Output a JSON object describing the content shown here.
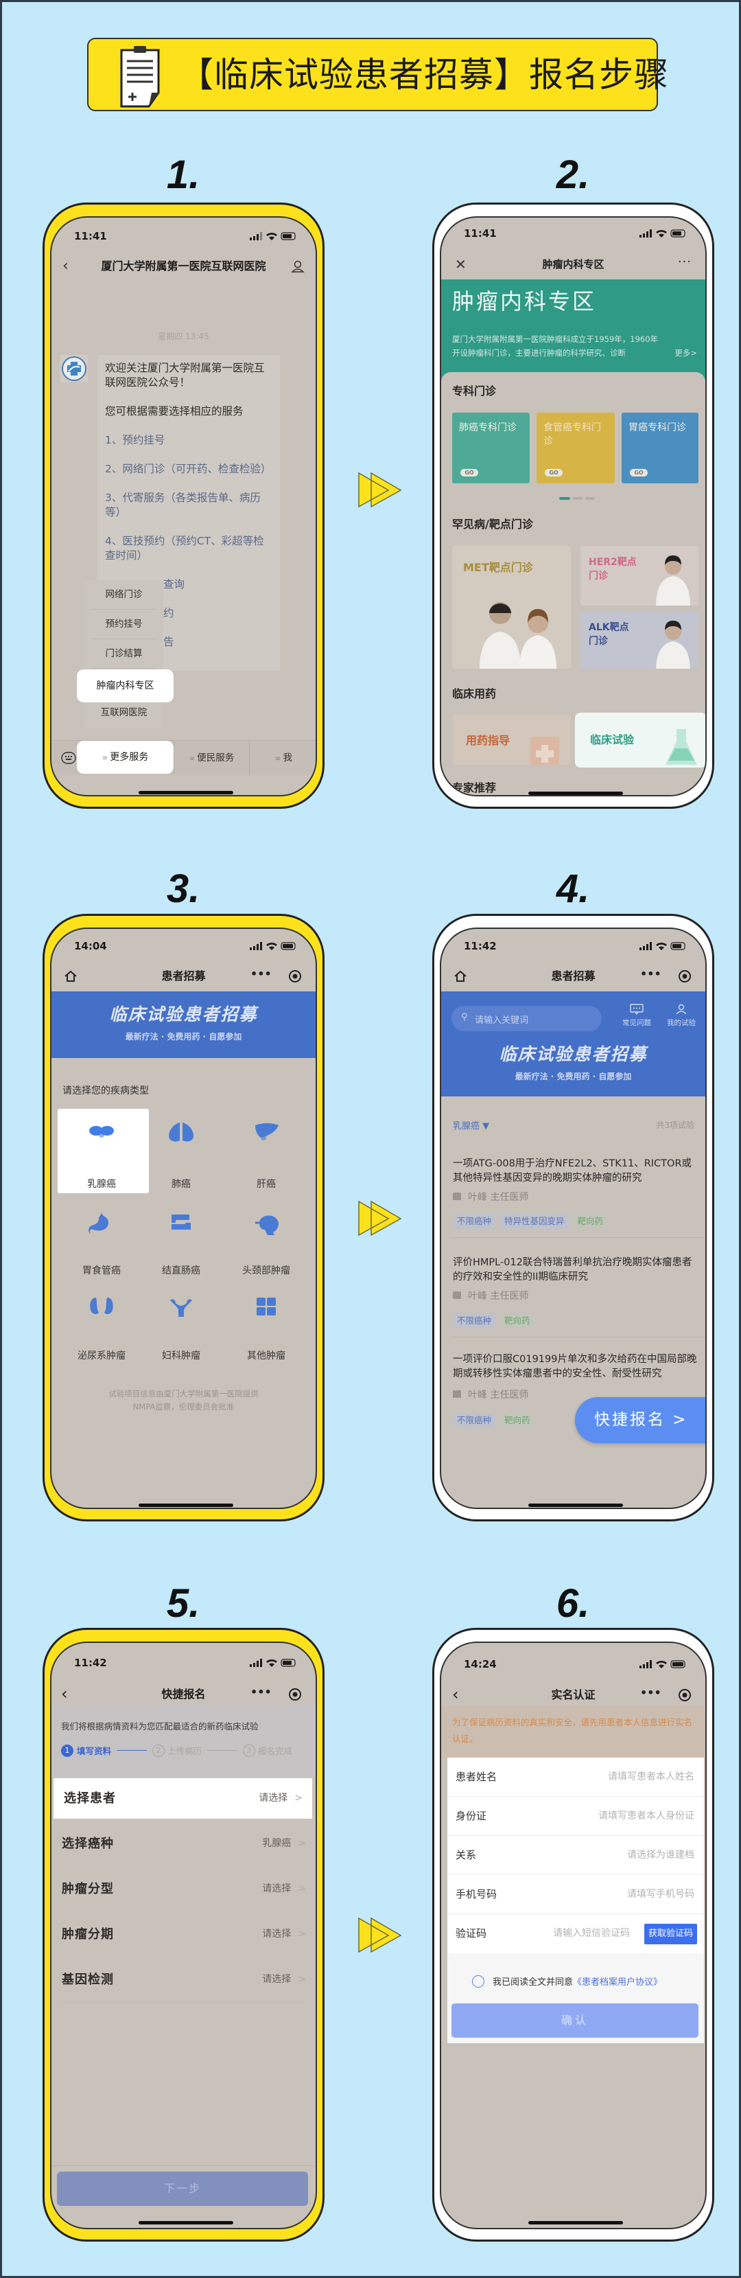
{
  "header": {
    "title": "【临床试验患者招募】报名步骤",
    "icon": "clipboard-medical-icon"
  },
  "colors": {
    "background": "#c3e9fa",
    "frame_yellow": "#fde21b",
    "frame_white": "#ffffff",
    "accent_blue": "#4470c8",
    "teal": "#2f9a86"
  },
  "steps": [
    "1.",
    "2.",
    "3.",
    "4.",
    "5.",
    "6."
  ],
  "phone1": {
    "time": "11:41",
    "nav_title": "厦门大学附属第一医院互联网医院",
    "date": "星期四 13:45",
    "bubble": {
      "welcome": "欢迎关注厦门大学附属第一医院互联网医院公众号！",
      "prompt": "您可根据需要选择相应的服务",
      "items": [
        "1、预约挂号",
        "2、网络门诊（可开药、检查检验）",
        "3、代寄服务（各类报告单、病历等）",
        "4、医技预约（预约CT、彩超等检查时间）"
      ],
      "hidden_fragments": [
        "查询",
        "约",
        "告"
      ]
    },
    "menu": [
      "网络门诊",
      "预约挂号",
      "门诊结算",
      "肿瘤内科专区",
      "互联网医院"
    ],
    "bottom_bar": [
      "更多服务",
      "便民服务",
      "我"
    ]
  },
  "phone2": {
    "time": "11:41",
    "nav_title": "肿瘤内科专区",
    "banner_title": "肿瘤内科专区",
    "banner_desc": "厦门大学附属附属第一医院肿瘤科成立于1959年，1960年开设肿瘤科门诊，主要进行肿瘤的科学研究、诊断",
    "banner_more": "更多>",
    "section1": "专科门诊",
    "clinics": [
      {
        "label": "肺癌专科门诊",
        "go": "GO"
      },
      {
        "label": "食管癌专科门诊",
        "go": "GO"
      },
      {
        "label": "胃癌专科门诊",
        "go": "GO"
      }
    ],
    "section2": "罕见病/靶点门诊",
    "targets": [
      "MET靶点门诊",
      "HER2靶点门诊",
      "ALK靶点门诊"
    ],
    "section3": "临床用药",
    "drugs": [
      "用药指导",
      "临床试验"
    ],
    "section4": "专家推荐"
  },
  "phone3": {
    "time": "14:04",
    "nav_title": "患者招募",
    "banner_title": "临床试验患者招募",
    "banner_sub": "最新疗法 · 免费用药 · 自愿参加",
    "prompt": "请选择您的疾病类型",
    "diseases": [
      "乳腺癌",
      "肺癌",
      "肝癌",
      "胃食管癌",
      "结直肠癌",
      "头颈部肿瘤",
      "泌尿系肿瘤",
      "妇科肿瘤",
      "其他肿瘤"
    ],
    "selected": "乳腺癌",
    "footer": [
      "试验项目信息由厦门大学附属第一医院提供",
      "NMPA监察，伦理委员会批准"
    ]
  },
  "phone4": {
    "time": "11:42",
    "nav_title": "患者招募",
    "search_placeholder": "请输入关键词",
    "faq": "常见问题",
    "my_trials": "我的试验",
    "banner_title": "临床试验患者招募",
    "banner_sub": "最新疗法 · 免费用药 · 自愿参加",
    "filter": "乳腺癌",
    "count": "共3项试验",
    "trials": [
      {
        "title": "一项ATG-008用于治疗NFE2L2、STK11、RICTOR或其他特异性基因变异的晚期实体肿瘤的研究",
        "doctor": "叶峰 主任医师",
        "tags": [
          "不限癌种",
          "特异性基因变异",
          "靶向药"
        ]
      },
      {
        "title": "评价HMPL-012联合特瑞普利单抗治疗晚期实体瘤患者的疗效和安全性的II期临床研究",
        "doctor": "叶峰 主任医师",
        "tags": [
          "不限癌种",
          "靶向药"
        ]
      },
      {
        "title": "一项评价口服C019199片单次和多次给药在中国局部晚期或转移性实体瘤患者中的安全性、耐受性研究",
        "doctor": "叶峰 主任医师",
        "tags": [
          "不限癌种",
          "靶向药"
        ]
      }
    ],
    "quick_signup": "快捷报名 >"
  },
  "phone5": {
    "time": "11:42",
    "nav_title": "快捷报名",
    "desc": "我们将根据病情资料为您匹配最适合的新药临床试验",
    "progress": [
      {
        "num": "1",
        "label": "填写资料"
      },
      {
        "num": "2",
        "label": "上传病历"
      },
      {
        "num": "3",
        "label": "报名完成"
      }
    ],
    "current_step": 1,
    "rows": [
      {
        "label": "选择患者",
        "value": "请选择"
      },
      {
        "label": "选择癌种",
        "value": "乳腺癌"
      },
      {
        "label": "肿瘤分型",
        "value": "请选择"
      },
      {
        "label": "肿瘤分期",
        "value": "请选择"
      },
      {
        "label": "基因检测",
        "value": "请选择"
      }
    ],
    "next": "下一步"
  },
  "phone6": {
    "time": "14:24",
    "nav_title": "实名认证",
    "notice": "为了保证病历资料的真实和安全，请先用患者本人信息进行实名认证。",
    "fields": [
      {
        "label": "患者姓名",
        "placeholder": "请填写患者本人姓名"
      },
      {
        "label": "身份证",
        "placeholder": "请填写患者本人身份证"
      },
      {
        "label": "关系",
        "placeholder": "请选择为谁建档"
      },
      {
        "label": "手机号码",
        "placeholder": "请填写手机号码"
      },
      {
        "label": "验证码",
        "placeholder": "请输入短信验证码"
      }
    ],
    "get_code": "获取验证码",
    "agree_text": "我已阅读全文并同意",
    "agree_link": "《患者档案用户协议》",
    "confirm": "确认"
  }
}
